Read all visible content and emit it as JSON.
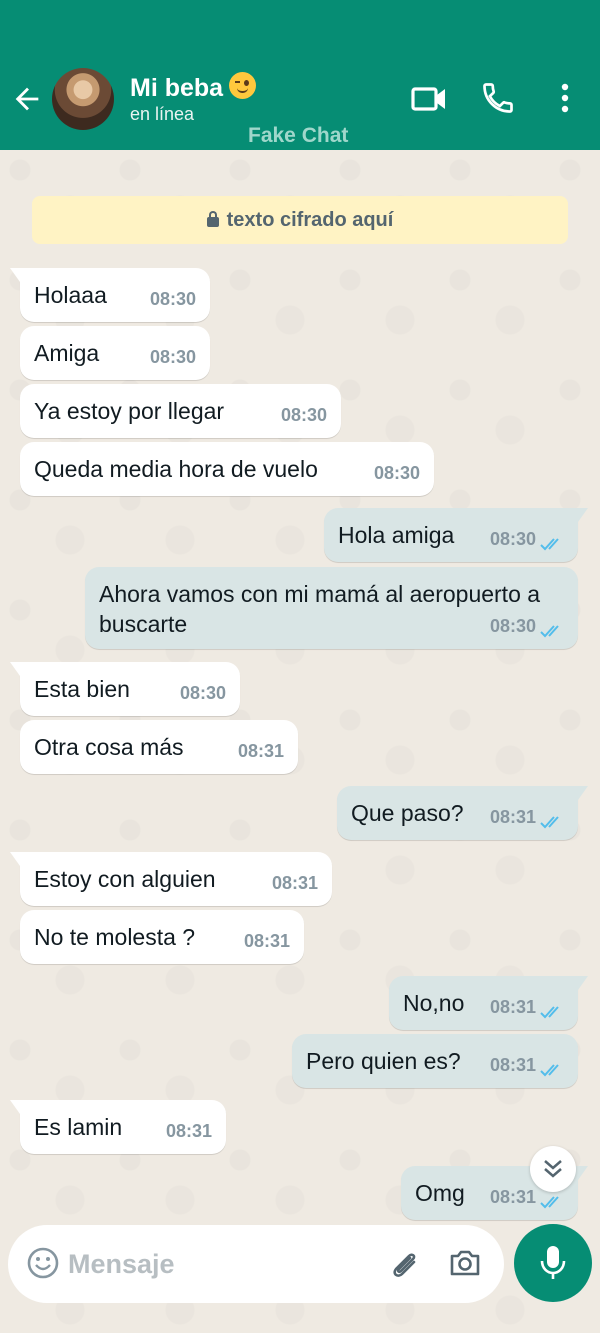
{
  "header": {
    "contact_name": "Mi beba",
    "emoji": "wink-emoji",
    "status": "en línea",
    "watermark": "Fake Chat",
    "colors": {
      "bar": "#068D74"
    }
  },
  "chat": {
    "encryption_notice": "texto cifrado aquí",
    "messages": [
      {
        "dir": "in",
        "text": "Holaaa",
        "time": "08:30"
      },
      {
        "dir": "in",
        "text": "Amiga",
        "time": "08:30"
      },
      {
        "dir": "in",
        "text": "Ya estoy por llegar",
        "time": "08:30"
      },
      {
        "dir": "in",
        "text": "Queda media hora de vuelo",
        "time": "08:30"
      },
      {
        "dir": "out",
        "text": "Hola amiga",
        "time": "08:30",
        "status": "read"
      },
      {
        "dir": "out",
        "text": "Ahora vamos con mi mamá al aeropuerto a buscarte",
        "time": "08:30",
        "status": "read"
      },
      {
        "dir": "in",
        "text": "Esta bien",
        "time": "08:30"
      },
      {
        "dir": "in",
        "text": "Otra cosa más",
        "time": "08:31"
      },
      {
        "dir": "out",
        "text": "Que paso?",
        "time": "08:31",
        "status": "read"
      },
      {
        "dir": "in",
        "text": "Estoy con alguien",
        "time": "08:31"
      },
      {
        "dir": "in",
        "text": "No te molesta ?",
        "time": "08:31"
      },
      {
        "dir": "out",
        "text": "No,no",
        "time": "08:31",
        "status": "read"
      },
      {
        "dir": "out",
        "text": "Pero quien es?",
        "time": "08:31",
        "status": "read"
      },
      {
        "dir": "in",
        "text": "Es lamin",
        "time": "08:31"
      },
      {
        "dir": "out",
        "text": "Omg",
        "time": "08:31",
        "status": "read"
      }
    ]
  },
  "composer": {
    "placeholder": "Mensaje",
    "colors": {
      "mic": "#068D74"
    }
  }
}
